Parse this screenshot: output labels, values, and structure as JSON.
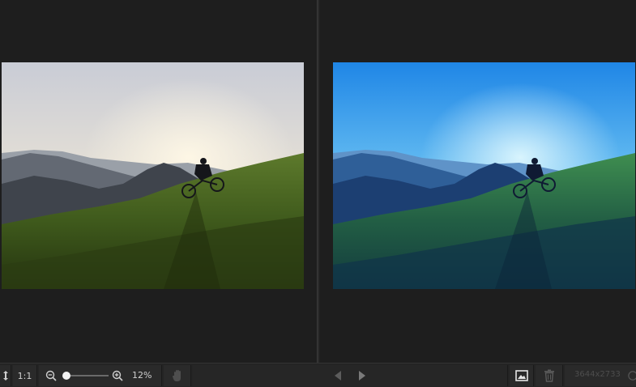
{
  "toolbar": {
    "actual_size_label": "1:1",
    "zoom_value": 0.08,
    "zoom_percent": "12%",
    "dimensions": "3644x2733"
  },
  "icons": {
    "fit": "fit-screen-icon",
    "zoom_out": "zoom-out-icon",
    "zoom_in": "zoom-in-icon",
    "hand": "hand-pan-icon",
    "prev": "previous-arrow-icon",
    "next": "next-arrow-icon",
    "image": "image-view-icon",
    "trash": "trash-icon",
    "info": "info-icon"
  },
  "colors": {
    "background": "#1e1e1e",
    "toolbar": "#242424",
    "original_sky": "#dcdde0",
    "edited_sky": "#4aa8f0"
  }
}
